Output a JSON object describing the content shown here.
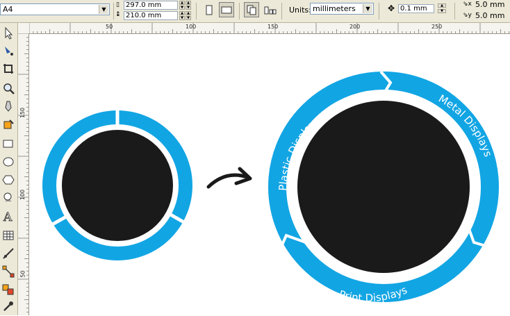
{
  "property_bar": {
    "paper_size": "A4",
    "width_value": "297.0 mm",
    "height_value": "210.0 mm",
    "units_label": "Units:",
    "units_value": "millimeters",
    "nudge_value": "0.1 mm",
    "dup_x_value": "5.0 mm",
    "dup_y_value": "5.0 mm"
  },
  "ruler": {
    "h_labels": [
      "50",
      "100",
      "150",
      "200",
      "250"
    ],
    "v_labels": [
      "150",
      "100",
      "50"
    ]
  },
  "toolbox": {
    "tools": [
      "pick-tool-icon",
      "shape-tool-icon",
      "crop-tool-icon",
      "zoom-tool-icon",
      "freehand-tool-icon",
      "smart-fill-tool-icon",
      "rectangle-tool-icon",
      "ellipse-tool-icon",
      "polygon-tool-icon",
      "basic-shapes-tool-icon",
      "text-tool-icon",
      "table-tool-icon",
      "dimension-tool-icon",
      "connector-tool-icon",
      "interactive-blend-tool-icon",
      "eyedropper-tool-icon"
    ]
  },
  "diagram": {
    "segments": [
      "Plastic Displays",
      "Metal Displays",
      "Print Displays"
    ],
    "colors": {
      "ring": "#12a5e4",
      "center": "#1a1a1a",
      "gap": "#ffffff",
      "arrow": "#1a1a1a"
    }
  }
}
